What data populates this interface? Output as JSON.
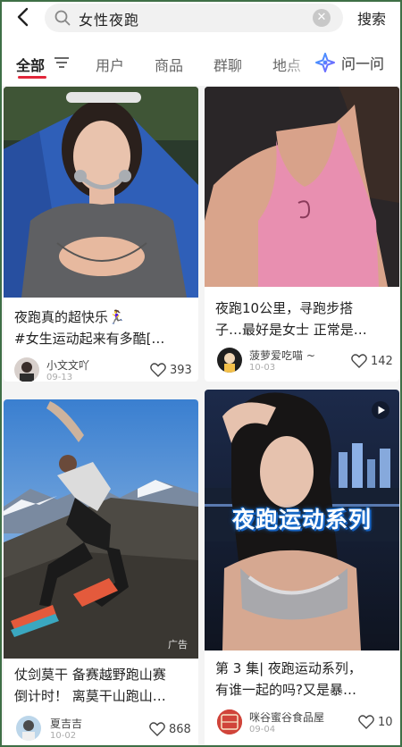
{
  "search": {
    "query": "女性夜跑",
    "submit_label": "搜索"
  },
  "tabs": [
    {
      "label": "全部",
      "active": true
    },
    {
      "label": "用户"
    },
    {
      "label": "商品"
    },
    {
      "label": "群聊"
    },
    {
      "label": "地点"
    }
  ],
  "ask_label": "问一问",
  "accent_color": "#e2263a",
  "cards": [
    {
      "title_lines": [
        "夜跑真的超快乐🏃‍♀️",
        "#女生运动起来有多酷[…"
      ],
      "author": "小文文吖",
      "date": "09-13",
      "likes": "393"
    },
    {
      "title_lines": [
        "夜跑10公里，寻跑步搭",
        "子…最好是女士 正常是…"
      ],
      "author": "菠萝爱吃喵 ~",
      "date": "10-03",
      "likes": "142"
    },
    {
      "title_lines": [
        "仗剑莫干 备赛越野跑山赛",
        "倒计时！ 离莫干山跑山…"
      ],
      "author": "夏吉吉",
      "date": "10-02",
      "likes": "868",
      "badge": "广告"
    },
    {
      "title_lines": [
        "第 3 集| 夜跑运动系列，",
        "有谁一起的吗?又是暴…"
      ],
      "author": "咪谷蜜谷食品屋",
      "date": "09-04",
      "likes": "10",
      "overlay": "夜跑运动系列",
      "avatar_text": "咪谷\n蜜谷"
    }
  ]
}
